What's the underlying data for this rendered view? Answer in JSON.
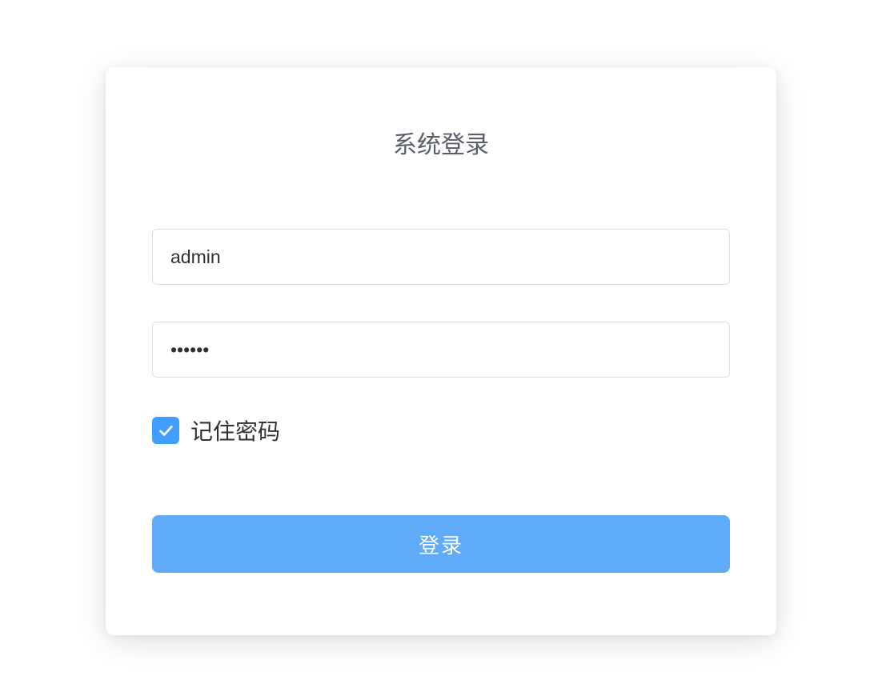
{
  "login": {
    "title": "系统登录",
    "username_value": "admin",
    "password_value": "••••••",
    "remember_label": "记住密码",
    "remember_checked": true,
    "submit_label": "登录"
  }
}
